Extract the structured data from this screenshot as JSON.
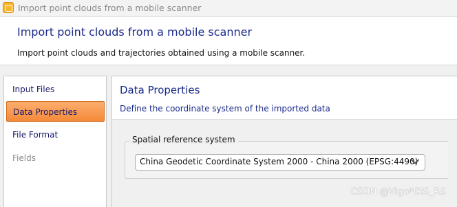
{
  "window": {
    "title": "Import point clouds from a mobile scanner",
    "icon": "app-icon"
  },
  "header": {
    "title": "Import point clouds from a mobile scanner",
    "subtitle": "Import point clouds and trajectories obtained using a mobile scanner."
  },
  "sidebar": {
    "items": [
      {
        "label": "Input Files",
        "state": "normal"
      },
      {
        "label": "Data Properties",
        "state": "active"
      },
      {
        "label": "File Format",
        "state": "normal"
      },
      {
        "label": "Fields",
        "state": "disabled"
      }
    ]
  },
  "main": {
    "title": "Data Properties",
    "subtitle": "Define the coordinate system of the imported data",
    "srs_group": {
      "label": "Spatial reference system",
      "selected": "China Geodetic Coordinate System 2000 - China 2000 (EPSG:4490)"
    }
  },
  "watermark": "CSDN @Vigo*GIS_RS",
  "colors": {
    "accent_title": "#1a2a8a",
    "active_item": "#f58a39"
  }
}
